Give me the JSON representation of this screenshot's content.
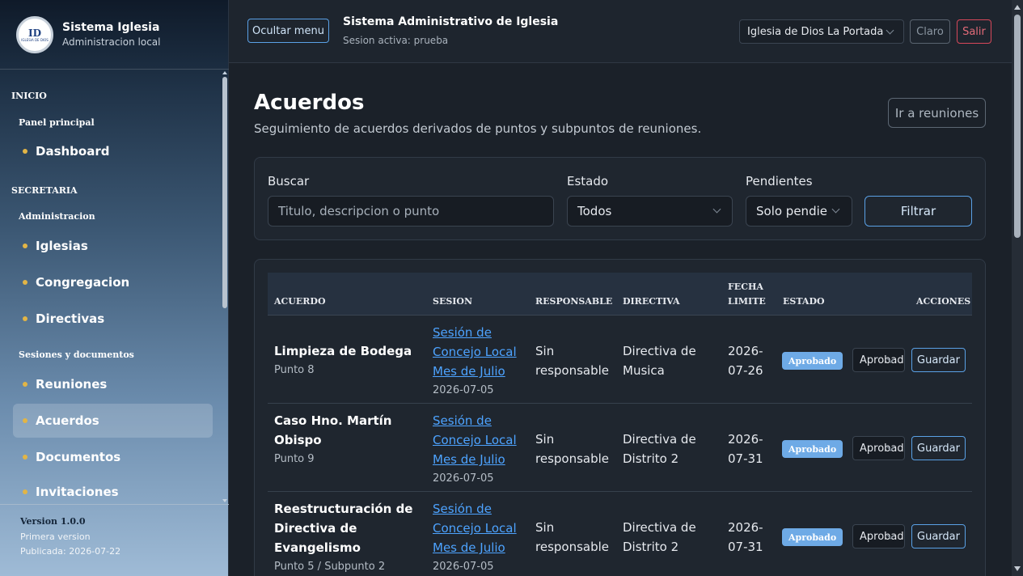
{
  "sidebar": {
    "brand_title": "Sistema Iglesia",
    "brand_subtitle": "Administracion local",
    "logo_text": "ID",
    "logo_small": "IGLESIA DE DIOS",
    "sections": [
      {
        "title": "INICIO"
      },
      {
        "title": "SECRETARIA"
      }
    ],
    "groups": [
      {
        "title": "Panel principal"
      },
      {
        "title": "Administracion"
      },
      {
        "title": "Sesiones y documentos"
      }
    ],
    "items": [
      {
        "label": "Dashboard"
      },
      {
        "label": "Iglesias"
      },
      {
        "label": "Congregacion"
      },
      {
        "label": "Directivas"
      },
      {
        "label": "Reuniones"
      },
      {
        "label": "Acuerdos"
      },
      {
        "label": "Documentos"
      },
      {
        "label": "Invitaciones"
      }
    ],
    "version_title": "Version 1.0.0",
    "version_desc": "Primera version",
    "version_published": "Publicada: 2026-07-22"
  },
  "topbar": {
    "hide_menu": "Ocultar menu",
    "title": "Sistema Administrativo de Iglesia",
    "session": "Sesion activa: prueba",
    "church_select": "Iglesia de Dios La Portada",
    "theme_button": "Claro",
    "logout_button": "Salir"
  },
  "page": {
    "title": "Acuerdos",
    "description": "Seguimiento de acuerdos derivados de puntos y subpuntos de reuniones.",
    "go_meetings": "Ir a reuniones"
  },
  "filters": {
    "search_label": "Buscar",
    "search_placeholder": "Titulo, descripcion o punto",
    "state_label": "Estado",
    "state_value": "Todos",
    "pending_label": "Pendientes",
    "pending_value": "Solo pendie",
    "filter_button": "Filtrar"
  },
  "table": {
    "headers": {
      "acuerdo": "ACUERDO",
      "sesion": "SESION",
      "responsable": "RESPONSABLE",
      "directiva": "DIRECTIVA",
      "fecha_1": "FECHA",
      "fecha_2": "LIMITE",
      "estado": "ESTADO",
      "acciones": "ACCIONES"
    },
    "rows": [
      {
        "title_1": "Limpieza de Bodega",
        "title_2": "",
        "point": "Punto 8",
        "session_1": "Sesión de",
        "session_2": "Concejo Local",
        "session_3": "Mes de Julio",
        "session_date": "2026-07-05",
        "resp_1": "Sin",
        "resp_2": "responsable",
        "dir_1": "Directiva de",
        "dir_2": "Musica",
        "date_1": "2026-",
        "date_2": "07-26",
        "status": "Aprobado",
        "select": "Aprobado",
        "save": "Guardar"
      },
      {
        "title_1": "Caso Hno. Martín",
        "title_2": "Obispo",
        "point": "Punto 9",
        "session_1": "Sesión de",
        "session_2": "Concejo Local",
        "session_3": "Mes de Julio",
        "session_date": "2026-07-05",
        "resp_1": "Sin",
        "resp_2": "responsable",
        "dir_1": "Directiva de",
        "dir_2": "Distrito 2",
        "date_1": "2026-",
        "date_2": "07-31",
        "status": "Aprobado",
        "select": "Aprobado",
        "save": "Guardar"
      },
      {
        "title_1": "Reestructuración de",
        "title_2": "Directiva de Evangelismo",
        "point": "Punto 5 / Subpunto 2",
        "session_1": "Sesión de",
        "session_2": "Concejo Local",
        "session_3": "Mes de Julio",
        "session_date": "2026-07-05",
        "resp_1": "Sin",
        "resp_2": "responsable",
        "dir_1": "Directiva de",
        "dir_2": "Distrito 2",
        "date_1": "2026-",
        "date_2": "07-31",
        "status": "Aprobado",
        "select": "Aprobado",
        "save": "Guardar"
      }
    ]
  },
  "colors": {
    "accent": "#5aa1e6",
    "link": "#4da3ff",
    "badge": "#6eaae6",
    "danger": "#d8485a",
    "nav_dot": "#e2b546"
  }
}
